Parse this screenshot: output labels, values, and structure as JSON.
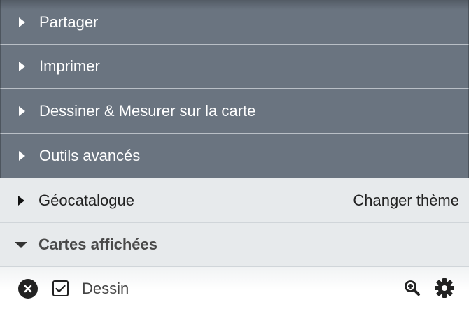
{
  "menu": {
    "share_label": "Partager",
    "print_label": "Imprimer",
    "draw_label": "Dessiner & Mesurer sur la carte",
    "advanced_label": "Outils avancés"
  },
  "catalog": {
    "label": "Géocatalogue",
    "change_theme_label": "Changer thème"
  },
  "displayed_maps": {
    "label": "Cartes affichées",
    "layers": [
      {
        "name": "Dessin",
        "checked": true
      }
    ]
  },
  "icons": {
    "collapsed": "caret-right-icon",
    "expanded": "caret-down-icon",
    "remove": "close-circle-icon",
    "checkbox": "checkbox-checked-icon",
    "zoom": "zoom-in-icon",
    "settings": "gear-icon"
  },
  "colors": {
    "menu_bg": "#6a7480",
    "section_bg": "#e7eaec",
    "text_dark": "#222222"
  }
}
